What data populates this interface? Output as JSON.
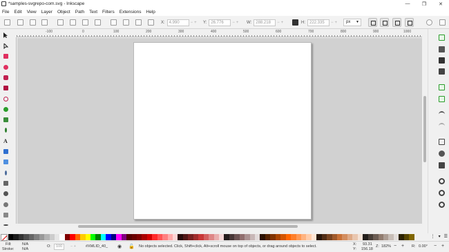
{
  "window": {
    "title": "*samples-svgrepo-com.svg - Inkscape",
    "controls": [
      "—",
      "❐",
      "✕"
    ]
  },
  "menu": [
    "File",
    "Edit",
    "View",
    "Layer",
    "Object",
    "Path",
    "Text",
    "Filters",
    "Extensions",
    "Help"
  ],
  "toolbar": {
    "x_label": "X:",
    "x_value": "4.990",
    "y_label": "Y:",
    "y_value": "26.776",
    "w_label": "W:",
    "w_value": "288.218",
    "h_label": "H:",
    "h_value": "222.335",
    "units": "px"
  },
  "ruler": {
    "ticks": [
      "-100",
      "0",
      "100",
      "200",
      "300",
      "400",
      "500",
      "600",
      "700",
      "800",
      "900",
      "1000"
    ]
  },
  "palette": {
    "swatches": [
      "#000000",
      "#1a1a1a",
      "#333333",
      "#4d4d4d",
      "#666666",
      "#808080",
      "#999999",
      "#b3b3b3",
      "#cccccc",
      "#e6e6e6",
      "#ffffff",
      "#800000",
      "#ff0000",
      "#ff6600",
      "#ffcc00",
      "#ffff00",
      "#00ff00",
      "#008000",
      "#00ffff",
      "#0000ff",
      "#000080",
      "#ff00ff",
      "#800080",
      "#550000",
      "#6b0000",
      "#800000",
      "#aa0000",
      "#d40000",
      "#ff2a2a",
      "#ff5555",
      "#ff8080",
      "#ffaaaa",
      "#ffd5d5",
      "#280b0b",
      "#501616",
      "#782121",
      "#a02c2c",
      "#c83737",
      "#d35f5f",
      "#de8787",
      "#e9afaf",
      "#f4d7d7",
      "#241c1c",
      "#483737",
      "#6c5353",
      "#916f6f",
      "#ac9393",
      "#c8b7b7",
      "#e3dbdb",
      "#2b1100",
      "#552200",
      "#803300",
      "#aa4400",
      "#d45500",
      "#ff6600",
      "#ff7f2a",
      "#ff9955",
      "#ffb380",
      "#ffccaa",
      "#ffe6d5",
      "#28170b",
      "#502d16",
      "#784421",
      "#a05a2c",
      "#c87137",
      "#d38d5f",
      "#deaa87",
      "#e9c6af",
      "#f4e3d7",
      "#241f1c",
      "#483e37",
      "#6c5d53",
      "#917c6f",
      "#ac9d93",
      "#c8beb7",
      "#e3dedb",
      "#2b2200",
      "#554400",
      "#806600"
    ],
    "controls": [
      "⋮",
      "▾",
      "☰"
    ]
  },
  "status": {
    "fill_label": "Fill:",
    "fill_value": "N/A",
    "stroke_label": "Stroke:",
    "stroke_value": "N/A",
    "opacity_label": "O:",
    "opacity_value": "100",
    "layer": "#XMLID_40_",
    "message": "No objects selected. Click, Shift+click, Alt+scroll mouse on top of objects, or drag around objects to select.",
    "x_label": "X:",
    "x_value": "93.31",
    "y_label": "Y:",
    "y_value": "156.18",
    "zoom_label": "Z:",
    "zoom_value": "182%",
    "rotate_label": "R:",
    "rotate_value": "0.00°"
  },
  "colors": {
    "canvas_bg": "#d1d1d1",
    "page_bg": "#ffffff",
    "accent_green": "#2a9d2a"
  }
}
